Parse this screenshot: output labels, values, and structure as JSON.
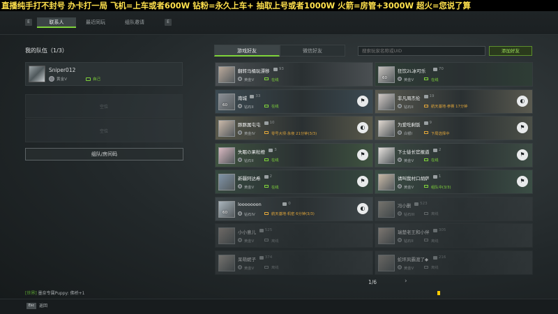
{
  "banner": {
    "text": "直播纯手打不封号 办卡打一局 飞机=上车或者600W 钻粉=永久上车+ 抽取上号或者1000W 火箭=房管+3000W 超火=您说了算"
  },
  "topbar": {
    "hint_left": "E",
    "hint_right": "E",
    "tabs": [
      {
        "label": "联系人",
        "active": true
      },
      {
        "label": "最近同玩",
        "active": false
      },
      {
        "label": "组队邀请",
        "active": false
      }
    ]
  },
  "team": {
    "title": "我的队伍（1/3）",
    "members": [
      {
        "name": "Sniper012",
        "rank": "黄金V",
        "status": "自己"
      }
    ],
    "empty_slots": [
      "空位",
      "空位"
    ],
    "room_button": "组队/房间码"
  },
  "friends_panel": {
    "subtabs": [
      {
        "label": "游戏好友",
        "active": true
      },
      {
        "label": "微信好友",
        "active": false
      }
    ],
    "search_placeholder": "搜索玩家名称或UID",
    "add_button": "添加好友",
    "friends": [
      {
        "name": "翻转马桶玩漂移",
        "badge": "93",
        "rank": "黄金V",
        "status": "在线",
        "status_color": "#7fd43a",
        "level": "",
        "action": "",
        "online": true,
        "bg": "#4a4f52"
      },
      {
        "name": "狂饮2L冰可乐",
        "badge": "70",
        "rank": "黄金V",
        "status": "在线",
        "status_color": "#7fd43a",
        "level": "60",
        "action": "",
        "online": true,
        "bg": "#2e3d35"
      },
      {
        "name": "南城",
        "badge": "33",
        "rank": "钻石II",
        "status": "在线",
        "status_color": "#7fd43a",
        "level": "60",
        "action": "⚑",
        "online": true,
        "bg": "#3c4a52"
      },
      {
        "name": "非凡周杰伦",
        "badge": "19",
        "rank": "钻石II",
        "status": "航天基地·参赛 17分钟",
        "status_color": "#e1a63a",
        "level": "",
        "action": "◐",
        "online": true,
        "bg": "#5a5a50"
      },
      {
        "name": "豚豚属屯屯",
        "badge": "10",
        "rank": "黄金IV",
        "status": "零号大坝·永夜 21分钟(3/3)",
        "status_color": "#e1a63a",
        "level": "",
        "action": "◐",
        "online": true,
        "bg": "#58584a"
      },
      {
        "name": "为爱吃剩饭",
        "badge": "9",
        "rank": "白银I",
        "status": "下局选择中",
        "status_color": "#e1a63a",
        "level": "",
        "action": "⚑",
        "online": true,
        "bg": "#4c5048"
      },
      {
        "name": "失眠の果粒橙",
        "badge": "3",
        "rank": "钻石II",
        "status": "在线",
        "status_color": "#7fd43a",
        "level": "",
        "action": "⚑",
        "online": true,
        "bg": "#3f5340"
      },
      {
        "name": "下士徒长官报道",
        "badge": "2",
        "rank": "黄金V",
        "status": "在线",
        "status_color": "#7fd43a",
        "level": "",
        "action": "⚑",
        "online": true,
        "bg": "#3d4c44"
      },
      {
        "name": "新疆阿达希",
        "badge": "2",
        "rank": "黄金V",
        "status": "在线",
        "status_color": "#7fd43a",
        "level": "",
        "action": "⚑",
        "online": true,
        "bg": "#36483f"
      },
      {
        "name": "请叫我村口胡萨",
        "badge": "1",
        "rank": "黄金V",
        "status": "组队中(3/3)",
        "status_color": "#7fd43a",
        "level": "",
        "action": "⚑",
        "online": true,
        "bg": "#3b4e45"
      },
      {
        "name": "looooooon",
        "badge": "0",
        "rank": "钻石IV",
        "status": "航天基地·机密 6分钟(3/3)",
        "status_color": "#e1a63a",
        "level": "60",
        "action": "◐",
        "online": true,
        "bg": "#3d4548"
      },
      {
        "name": "冯小删",
        "badge": "523",
        "rank": "钻石III",
        "status": "离线",
        "status_color": "#8a8f91",
        "level": "",
        "action": "",
        "online": false,
        "bg": "#3a4042"
      },
      {
        "name": "小小意儿",
        "badge": "525",
        "rank": "黄金V",
        "status": "离线",
        "status_color": "#8a8f91",
        "level": "",
        "action": "",
        "online": false,
        "bg": "#3a4042"
      },
      {
        "name": "瑞楚老王和小伴",
        "badge": "305",
        "rank": "钻石II",
        "status": "离线",
        "status_color": "#8a8f91",
        "level": "",
        "action": "",
        "online": false,
        "bg": "#3a4042"
      },
      {
        "name": "呆萌妮子",
        "badge": "374",
        "rank": "黄金V",
        "status": "离线",
        "status_color": "#8a8f91",
        "level": "",
        "action": "",
        "online": false,
        "bg": "#3a4042"
      },
      {
        "name": "蛇坪风霸渡了◆",
        "badge": "216",
        "rank": "黄金V",
        "status": "离线",
        "status_color": "#8a8f91",
        "level": "",
        "action": "",
        "online": false,
        "bg": "#3a4042"
      }
    ],
    "pager": {
      "text": "1/6",
      "next": "›"
    }
  },
  "chat": {
    "channel": "[世界]",
    "message": "墨奈专属Puppy: 佛桥+1"
  },
  "bottom": {
    "esc_key": "Esc",
    "esc_label": "返回"
  }
}
